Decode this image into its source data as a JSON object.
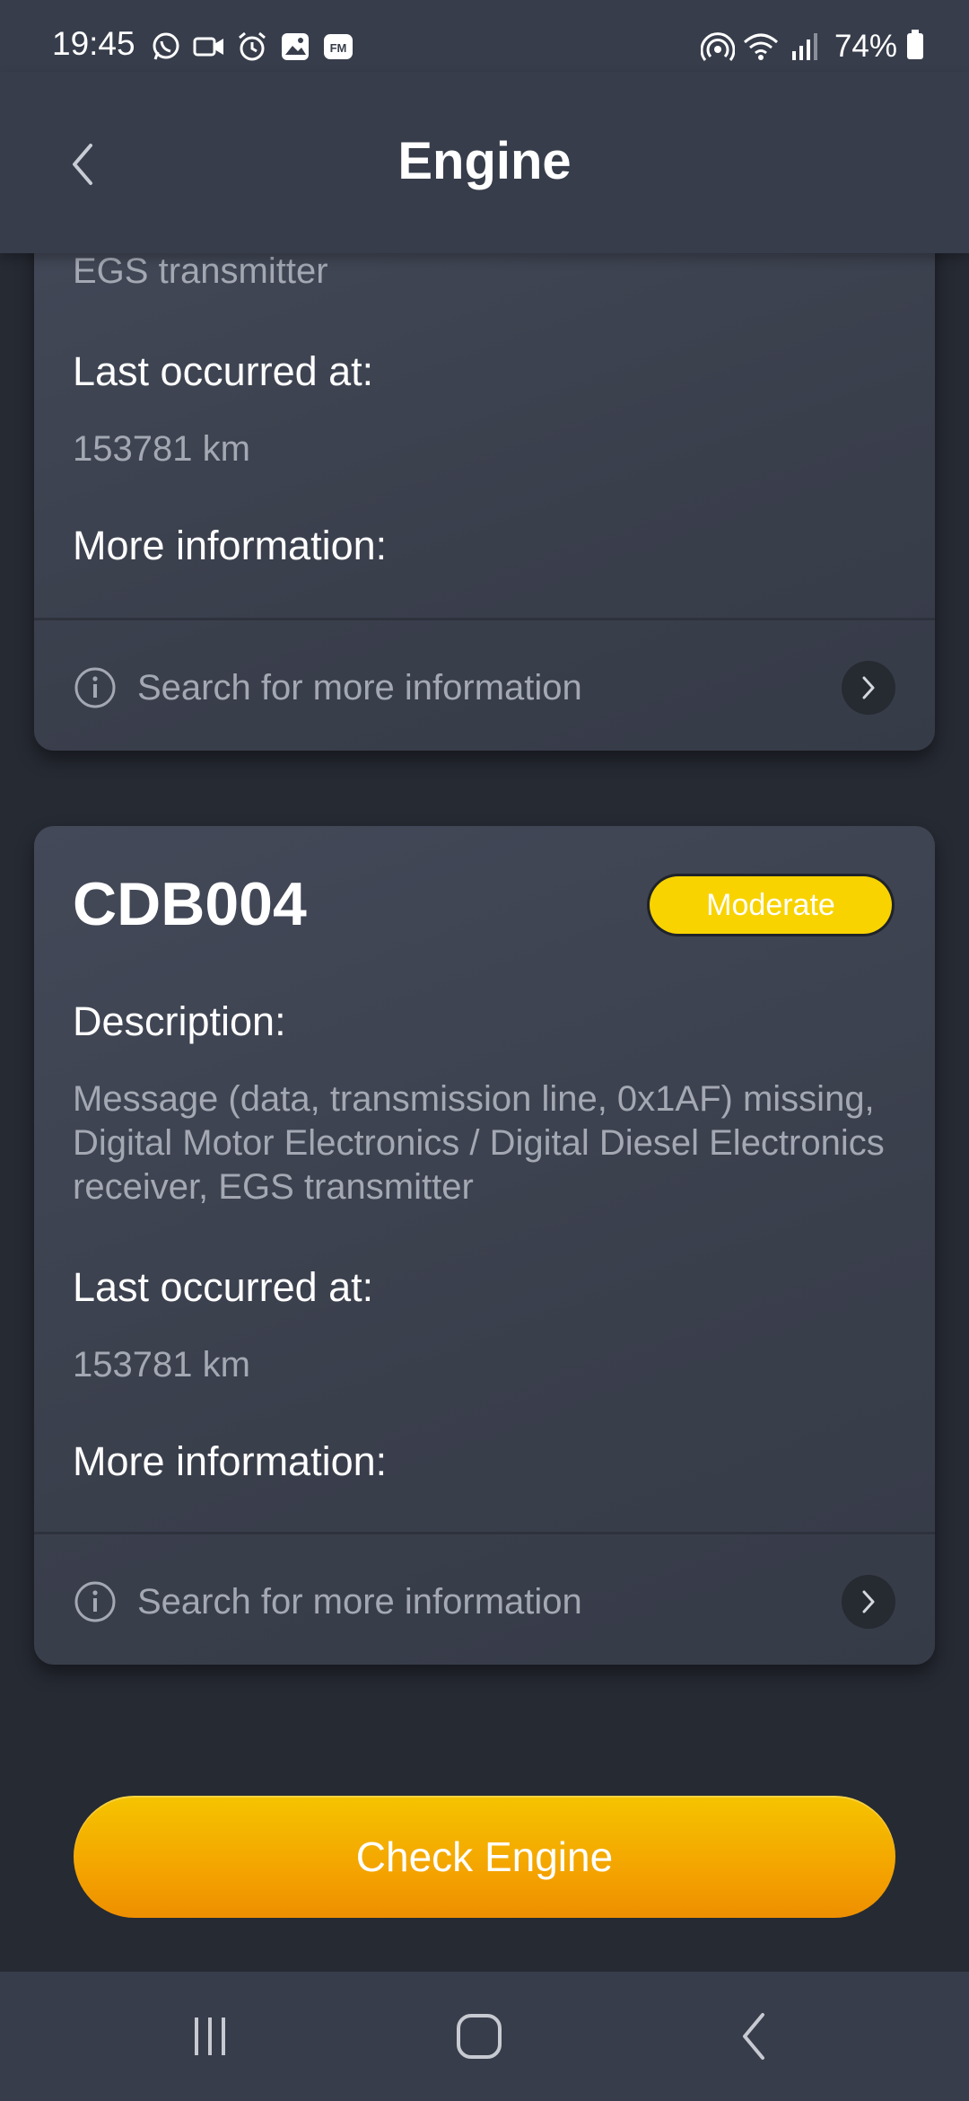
{
  "status_bar": {
    "time": "19:45",
    "left_icons": [
      "whatsapp-icon",
      "video-call-icon",
      "alarm-icon",
      "gallery-icon",
      "fm-icon"
    ],
    "right_icons": [
      "hotspot-icon",
      "wifi-icon",
      "signal-icon"
    ],
    "battery": "74%"
  },
  "header": {
    "title": "Engine",
    "back_icon": "chevron-left-icon"
  },
  "cards": [
    {
      "description_tail": "EGS transmitter",
      "last_occurred_label": "Last occurred at:",
      "last_occurred_value": "153781 km",
      "more_info_label": "More information:",
      "search_label": "Search for more information"
    },
    {
      "code": "CDB004",
      "severity": "Moderate",
      "severity_color": "#f8d300",
      "description_label": "Description:",
      "description": "Message (data, transmission line, 0x1AF) missing, Digital Motor Electronics / Digital Diesel Electronics receiver, EGS transmitter",
      "last_occurred_label": "Last occurred at:",
      "last_occurred_value": "153781 km",
      "more_info_label": "More information:",
      "search_label": "Search for more information"
    }
  ],
  "cta": {
    "label": "Check Engine",
    "color": "#f4a400"
  },
  "nav_bar": {
    "icons": [
      "recents-icon",
      "home-icon",
      "back-icon"
    ]
  }
}
